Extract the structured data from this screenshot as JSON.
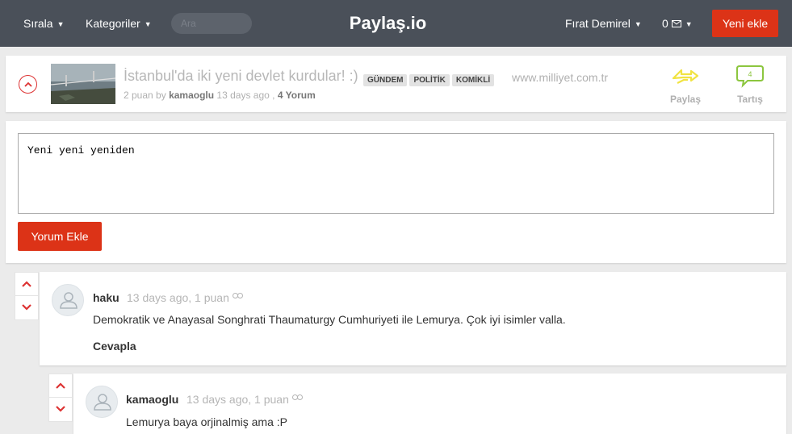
{
  "navbar": {
    "sort_label": "Sırala",
    "categories_label": "Kategoriler",
    "search_placeholder": "Ara",
    "brand": "Paylaş.io",
    "user_name": "Fırat Demirel",
    "messages_count": "0",
    "new_button": "Yeni ekle"
  },
  "post": {
    "title": "İstanbul'da iki yeni devlet kurdular! :)",
    "tags": [
      "GÜNDEM",
      "POLİTİK",
      "KOMİKLİ"
    ],
    "domain": "www.milliyet.com.tr",
    "points": "2 puan by",
    "author": "kamaoglu",
    "time": "13 days ago ,",
    "comments_link": "4 Yorum",
    "share_label": "Paylaş",
    "discuss_label": "Tartış",
    "discuss_count": "4"
  },
  "comment_form": {
    "value": "Yeni yeni yeniden",
    "submit_label": "Yorum Ekle"
  },
  "comments": [
    {
      "author": "haku",
      "meta": "13 days ago,  1 puan",
      "text": "Demokratik ve Anayasal Songhrati Thaumaturgy Cumhuriyeti ile Lemurya. Çok iyi isimler valla.",
      "reply_label": "Cevapla"
    },
    {
      "author": "kamaoglu",
      "meta": "13 days ago,  1 puan",
      "text": "Lemurya baya orjinalmiş ama :P"
    }
  ],
  "colors": {
    "navbar": "#4a5059",
    "accent": "#dc3317",
    "share": "#f1e342",
    "discuss": "#8cc63f"
  }
}
